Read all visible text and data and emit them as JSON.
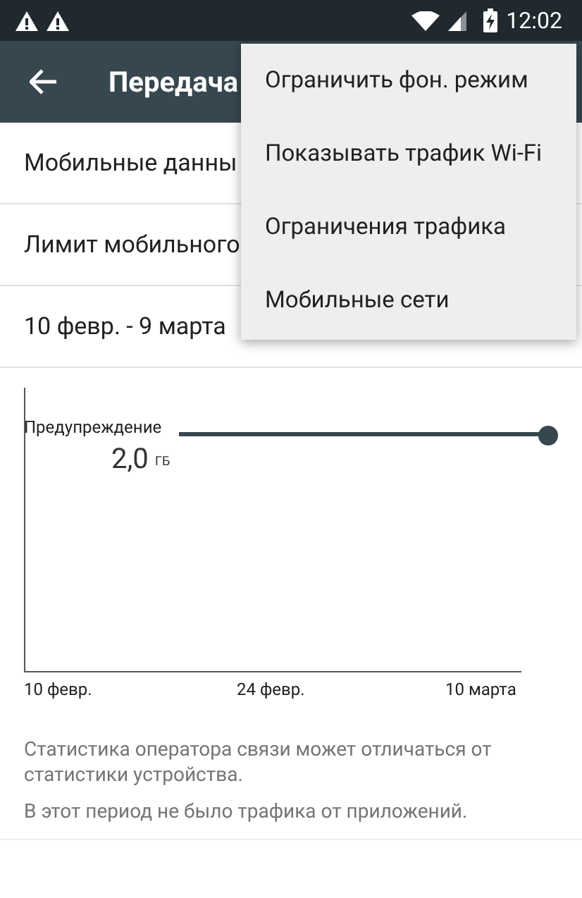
{
  "status_bar": {
    "time": "12:02"
  },
  "toolbar": {
    "title": "Передача"
  },
  "rows": [
    {
      "text": "Мобильные данны"
    },
    {
      "text": "Лимит мобильного"
    },
    {
      "text": "10 февр. - 9 марта"
    }
  ],
  "menu": {
    "items": [
      {
        "label": "Ограничить фон. режим"
      },
      {
        "label": "Показывать трафик Wi-Fi"
      },
      {
        "label": "Ограничения трафика"
      },
      {
        "label": "Мобильные сети"
      }
    ]
  },
  "chart": {
    "warning_label": "Предупреждение",
    "warning_value": "2,0",
    "warning_unit": "ГБ",
    "x_labels": [
      "10 февр.",
      "24 февр.",
      "10 марта"
    ]
  },
  "notes": [
    "Статистика оператора связи может отличаться от статистики устройства.",
    "В этот период не было трафика от приложений."
  ]
}
